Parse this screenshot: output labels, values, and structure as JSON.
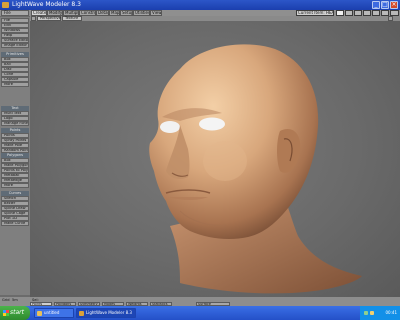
{
  "window": {
    "title": "LightWave Modeler 8.3"
  },
  "menu_button": "File",
  "tabs": [
    {
      "label": "Create",
      "active": true
    },
    {
      "label": "Modify",
      "active": false
    },
    {
      "label": "Multiply",
      "active": false
    },
    {
      "label": "Construct",
      "active": false
    },
    {
      "label": "Detail",
      "active": false
    },
    {
      "label": "Map",
      "active": false
    },
    {
      "label": "Setup",
      "active": false
    },
    {
      "label": "Utilities",
      "active": false
    },
    {
      "label": "View",
      "active": false
    }
  ],
  "layer_field": "Current Item: HEAD",
  "sidebar": {
    "top": [
      "File",
      "Edit",
      "Windows",
      "Help",
      "Surface Editor",
      "Image Editor"
    ],
    "sections": [
      {
        "head": "Primitives",
        "items": [
          "Box",
          "Ball",
          "Disc",
          "Cone",
          "Capsule",
          "More"
        ]
      },
      {
        "head": "Text",
        "items": [
          "Multi Text",
          "Logo",
          "Manage Fonts"
        ]
      },
      {
        "head": "Points",
        "items": [
          "Points",
          "Spray Points",
          "Make Pole",
          "Random Points"
        ]
      },
      {
        "head": "Polygons",
        "items": [
          "Box",
          "Make Polygon",
          "Points to Poly",
          "Metaball",
          "Metaedge",
          "More"
        ]
      },
      {
        "head": "Curves",
        "items": [
          "Sketch",
          "Bezier",
          "Spline Draw",
          "Spline Cage",
          "Plot 1D",
          "Make Curve"
        ]
      }
    ]
  },
  "viewport": {
    "view_mode": "Perspective",
    "shading": "Texture"
  },
  "status": {
    "grid_label": "Grid",
    "grid_value": "5m",
    "sel_label": "Sel:",
    "modes": [
      {
        "label": "Points",
        "on": true
      },
      {
        "label": "Polygons",
        "on": false
      },
      {
        "label": "Symmetry",
        "on": false
      },
      {
        "label": "Modes",
        "on": false
      },
      {
        "label": "Weights",
        "on": false
      },
      {
        "label": "Statistics",
        "on": false
      },
      {
        "label": "Surface",
        "on": false
      }
    ]
  },
  "taskbar": {
    "start": "start",
    "apps": [
      "untitled",
      "LightWave Modeler 8.3"
    ],
    "clock": "00:41"
  },
  "colors": {
    "skin": "#d8a77c",
    "viewport": "#6a6a6a",
    "taskbar": "#2f5fd8"
  }
}
